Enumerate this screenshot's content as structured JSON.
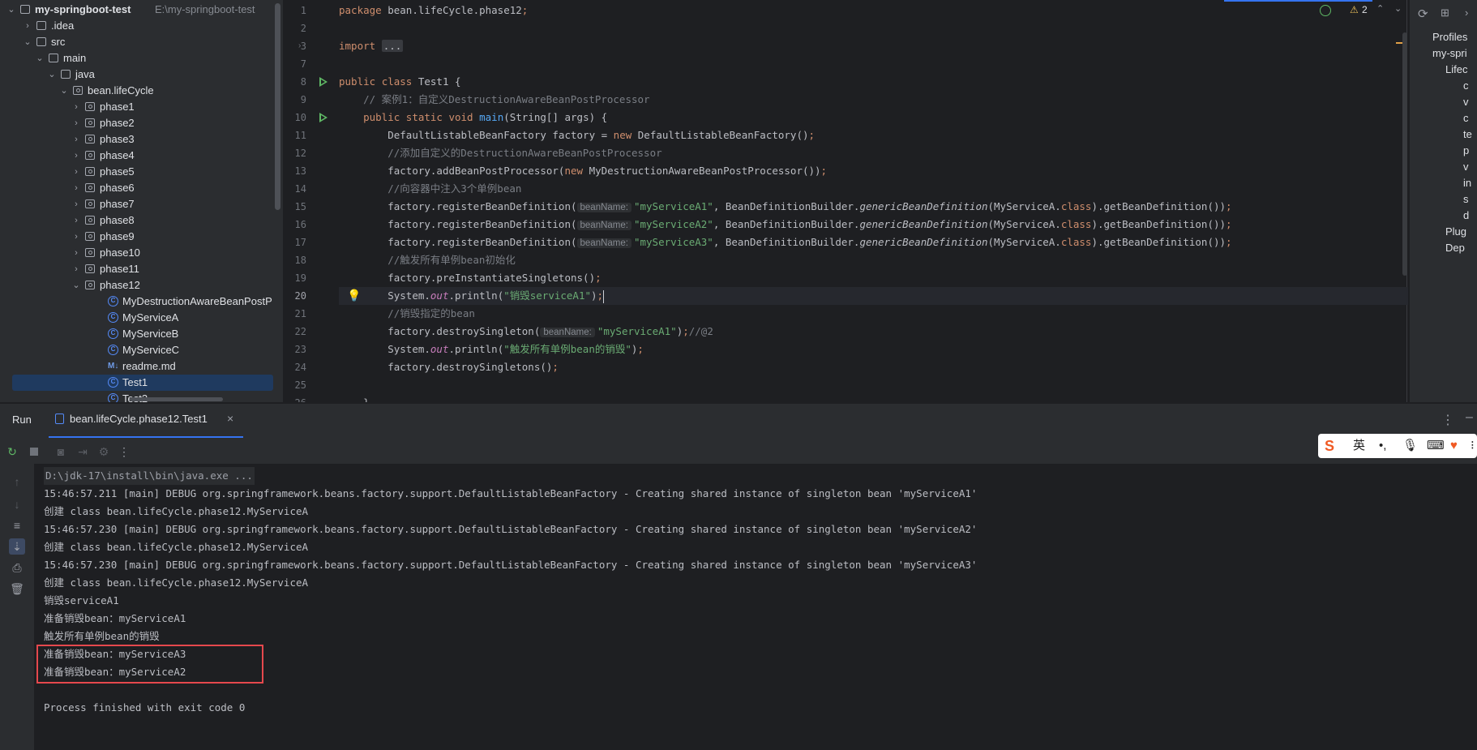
{
  "project_tree": {
    "root_label": "my-springboot-test",
    "root_path": "E:\\my-springboot-test",
    "items": [
      {
        "label": "my-springboot-test",
        "type": "root"
      },
      {
        "label": ".idea",
        "type": "folder"
      },
      {
        "label": "src",
        "type": "folder"
      },
      {
        "label": "main",
        "type": "folder"
      },
      {
        "label": "java",
        "type": "folder"
      },
      {
        "label": "bean.lifeCycle",
        "type": "package"
      },
      {
        "label": "phase1",
        "type": "package"
      },
      {
        "label": "phase2",
        "type": "package"
      },
      {
        "label": "phase3",
        "type": "package"
      },
      {
        "label": "phase4",
        "type": "package"
      },
      {
        "label": "phase5",
        "type": "package"
      },
      {
        "label": "phase6",
        "type": "package"
      },
      {
        "label": "phase7",
        "type": "package"
      },
      {
        "label": "phase8",
        "type": "package"
      },
      {
        "label": "phase9",
        "type": "package"
      },
      {
        "label": "phase10",
        "type": "package"
      },
      {
        "label": "phase11",
        "type": "package"
      },
      {
        "label": "phase12",
        "type": "package"
      },
      {
        "label": "MyDestructionAwareBeanPostP",
        "type": "class"
      },
      {
        "label": "MyServiceA",
        "type": "class"
      },
      {
        "label": "MyServiceB",
        "type": "class"
      },
      {
        "label": "MyServiceC",
        "type": "class"
      },
      {
        "label": "readme.md",
        "type": "markdown"
      },
      {
        "label": "Test1",
        "type": "class",
        "selected": true
      },
      {
        "label": "Test2",
        "type": "class"
      }
    ]
  },
  "editor": {
    "warnings_count": "2",
    "line_numbers": [
      "1",
      "2",
      "3",
      "7",
      "8",
      "9",
      "10",
      "11",
      "12",
      "13",
      "14",
      "15",
      "16",
      "17",
      "18",
      "19",
      "20",
      "21",
      "22",
      "23",
      "24",
      "25",
      "26"
    ],
    "current_line": "20",
    "code": {
      "l1_package_kw": "package",
      "l1_package_name": " bean.lifeCycle.phase12",
      "l1_semi": ";",
      "l3_import": "import",
      "l3_fold": "...",
      "l7_public": "public",
      "l7_class": "class",
      "l7_name": " Test1 {",
      "l8_comment": "// 案例1：自定义DestructionAwareBeanPostProcessor",
      "l9_public": "public",
      "l9_static": "static",
      "l9_void": "void",
      "l9_main": "main",
      "l9_rest": "(String[] args) {",
      "l10_a": "DefaultListableBeanFactory factory = ",
      "l10_new": "new",
      "l10_b": " DefaultListableBeanFactory()",
      "l11_comment": "//添加自定义的DestructionAwareBeanPostProcessor",
      "l12_a": "factory.addBeanPostProcessor(",
      "l12_new": "new",
      "l12_b": " MyDestructionAwareBeanPostProcessor())",
      "l13_comment": "//向容器中注入3个单例bean",
      "l14_a": "factory.registerBeanDefinition(",
      "hint_beanName": "beanName:",
      "l14_str": "\"myServiceA1\"",
      "l15_str": "\"myServiceA2\"",
      "l16_str": "\"myServiceA3\"",
      "reg_mid": ", BeanDefinitionBuilder.",
      "reg_generic": "genericBeanDefinition",
      "reg_arg": "(MyServiceA.",
      "reg_class": "class",
      "reg_end": ").getBeanDefinition())",
      "l17_comment": "//触发所有单例bean初始化",
      "l18": "factory.preInstantiateSingletons()",
      "l19_a": "System.",
      "l19_out": "out",
      "l19_b": ".println(",
      "l19_str": "\"销毁serviceA1\"",
      "l19_c": ")",
      "l20_comment": "//销毁指定的bean",
      "l21_a": "factory.destroySingleton(",
      "l21_str": "\"myServiceA1\"",
      "l21_c": ")",
      "l21_comment": "//@2",
      "l22_str": "\"触发所有单例bean的销毁\"",
      "l23": "factory.destroySingletons()",
      "l25": "}",
      "semi": ";"
    }
  },
  "maven": {
    "items": [
      "Profiles",
      "my-spri",
      "Lifec",
      "c",
      "v",
      "c",
      "te",
      "p",
      "v",
      "in",
      "s",
      "d",
      "Plug",
      "Dep"
    ]
  },
  "run_panel": {
    "title": "Run",
    "tab_label": "bean.lifeCycle.phase12.Test1",
    "console_lines": [
      "D:\\jdk-17\\install\\bin\\java.exe ...",
      "15:46:57.211 [main] DEBUG org.springframework.beans.factory.support.DefaultListableBeanFactory - Creating shared instance of singleton bean 'myServiceA1'",
      "创建 class bean.lifeCycle.phase12.MyServiceA",
      "15:46:57.230 [main] DEBUG org.springframework.beans.factory.support.DefaultListableBeanFactory - Creating shared instance of singleton bean 'myServiceA2'",
      "创建 class bean.lifeCycle.phase12.MyServiceA",
      "15:46:57.230 [main] DEBUG org.springframework.beans.factory.support.DefaultListableBeanFactory - Creating shared instance of singleton bean 'myServiceA3'",
      "创建 class bean.lifeCycle.phase12.MyServiceA",
      "销毁serviceA1",
      "准备销毁bean：myServiceA1",
      "触发所有单例bean的销毁",
      "准备销毁bean：myServiceA3",
      "准备销毁bean：myServiceA2",
      "",
      "Process finished with exit code 0"
    ]
  },
  "ime": {
    "lang": "英"
  },
  "colors": {
    "accent": "#3574f0",
    "highlight_box": "#e5484d",
    "run_green": "#5fb865"
  }
}
